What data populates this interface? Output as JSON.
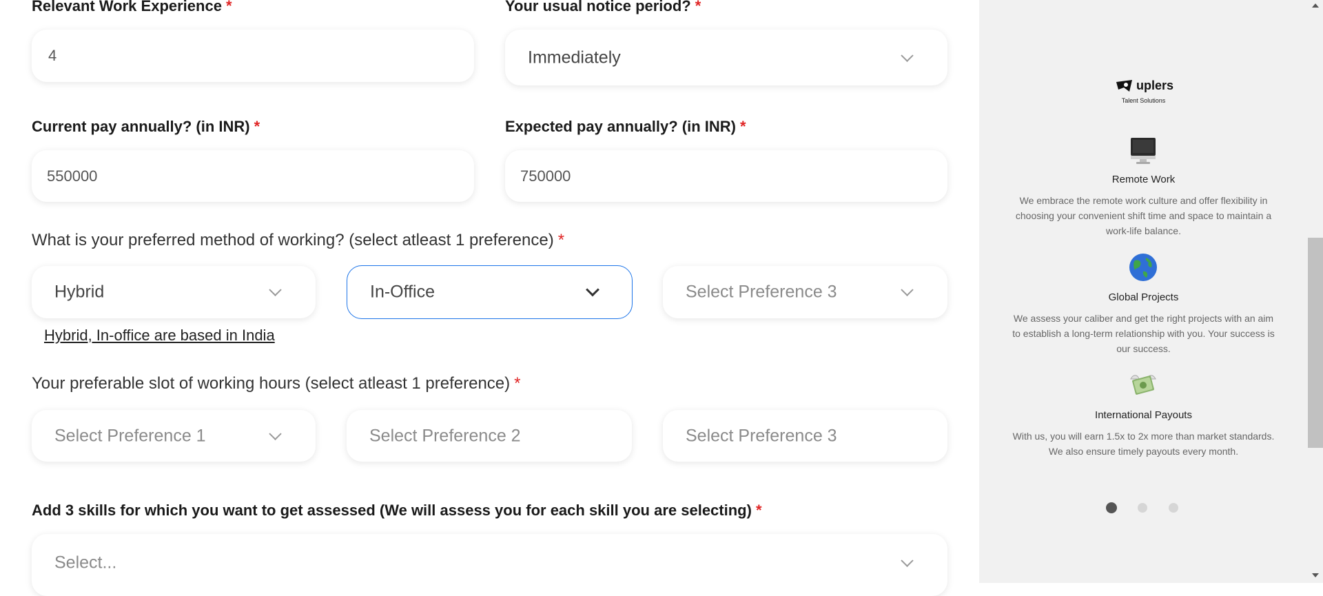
{
  "form": {
    "experience": {
      "label": "Relevant Work Experience",
      "required": "*",
      "value": "4"
    },
    "notice": {
      "label": "Your usual notice period?",
      "required": "*",
      "value": "Immediately"
    },
    "current_pay": {
      "label": "Current pay annually? (in INR)",
      "required": "*",
      "value": "550000"
    },
    "expected_pay": {
      "label": "Expected pay annually? (in INR)",
      "required": "*",
      "value": "750000"
    },
    "working_method": {
      "label": "What is your preferred method of working? (select atleast 1 preference)",
      "required": "*",
      "pref1": "Hybrid",
      "pref2": "In-Office",
      "pref3": "Select Preference 3",
      "note": "Hybrid, In-office are based in India"
    },
    "working_hours": {
      "label": "Your preferable slot of working hours (select atleast 1 preference)",
      "required": "*",
      "pref1": "Select Preference 1",
      "pref2": "Select Preference 2",
      "pref3": "Select Preference 3"
    },
    "skills": {
      "label": "Add 3 skills for which you want to get assessed (We will assess you for each skill you are selecting)",
      "required": "*",
      "placeholder": "Select..."
    }
  },
  "sidebar": {
    "brand": "uplers",
    "tagline": "Talent Solutions",
    "features": [
      {
        "icon": "computer-icon",
        "title": "Remote Work",
        "desc": "We embrace the remote work culture and offer flexibility in choosing your convenient shift time and space to maintain a work-life balance."
      },
      {
        "icon": "globe-icon",
        "title": "Global Projects",
        "desc": "We assess your caliber and get the right projects with an aim to establish a long-term relationship with you. Your success is our success."
      },
      {
        "icon": "money-wings-icon",
        "title": "International Payouts",
        "desc": "With us, you will earn 1.5x to 2x more than market standards. We also ensure timely payouts every month."
      }
    ],
    "carousel": {
      "active": 1,
      "count": 3
    }
  },
  "colors": {
    "required": "#e02424",
    "focus": "#1a73e8",
    "sidebar_bg": "#f1f1f1"
  }
}
